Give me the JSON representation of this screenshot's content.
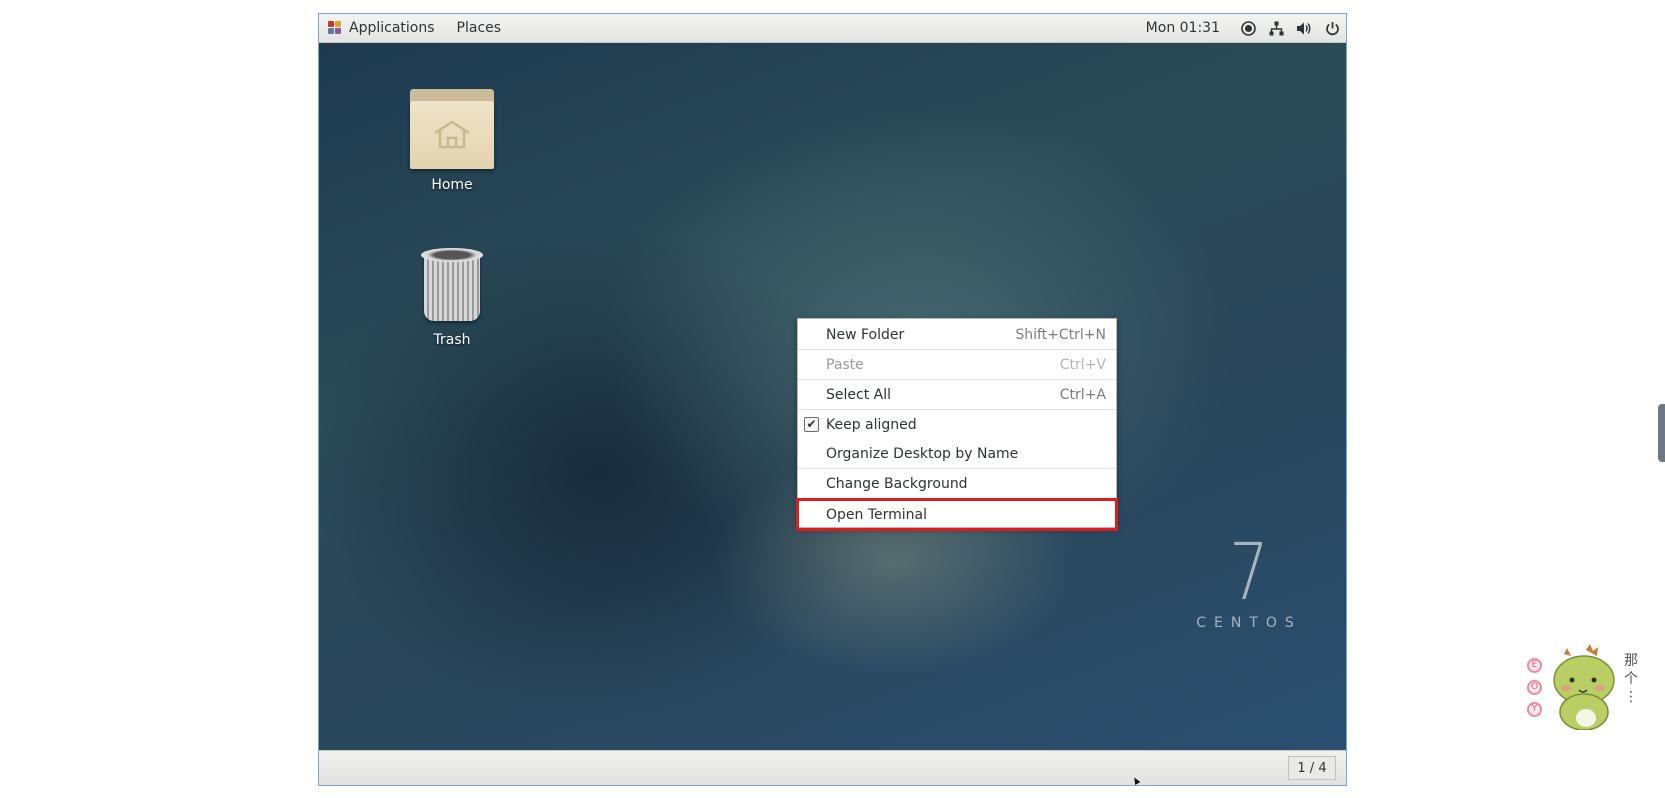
{
  "top_bar": {
    "applications_label": "Applications",
    "places_label": "Places",
    "clock": "Mon 01:31"
  },
  "desktop": {
    "icons": [
      {
        "label": "Home"
      },
      {
        "label": "Trash"
      }
    ],
    "centos_version": "7",
    "centos_word": "CENTOS"
  },
  "context_menu": {
    "items": [
      {
        "label": "New Folder",
        "shortcut": "Shift+Ctrl+N",
        "enabled": true
      },
      {
        "label": "Paste",
        "shortcut": "Ctrl+V",
        "enabled": false
      },
      {
        "label": "Select All",
        "shortcut": "Ctrl+A",
        "enabled": true
      },
      {
        "label": "Keep aligned",
        "checked": true,
        "enabled": true
      },
      {
        "label": "Organize Desktop by Name",
        "enabled": true
      },
      {
        "label": "Change Background",
        "enabled": true
      },
      {
        "label": "Open Terminal",
        "enabled": true,
        "highlighted": true
      }
    ],
    "highlight_color": "#e01b1b"
  },
  "bottom_bar": {
    "workspace": "1 / 4"
  },
  "sticker": {
    "badges": [
      "E",
      "O",
      "Y"
    ],
    "caption": "那\n个\n..."
  }
}
